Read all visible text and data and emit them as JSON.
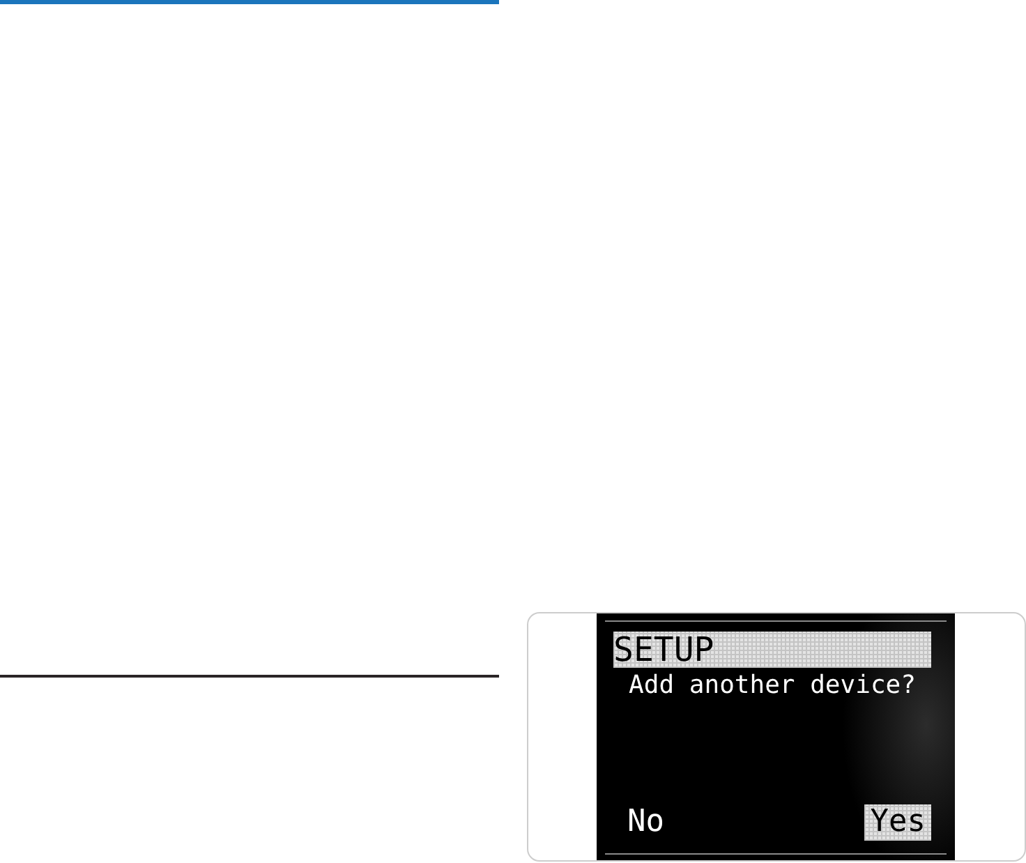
{
  "display": {
    "title": "SETUP",
    "prompt": "Add another device?",
    "options": [
      {
        "label": "No",
        "selected": false
      },
      {
        "label": "Yes",
        "selected": true
      }
    ]
  }
}
